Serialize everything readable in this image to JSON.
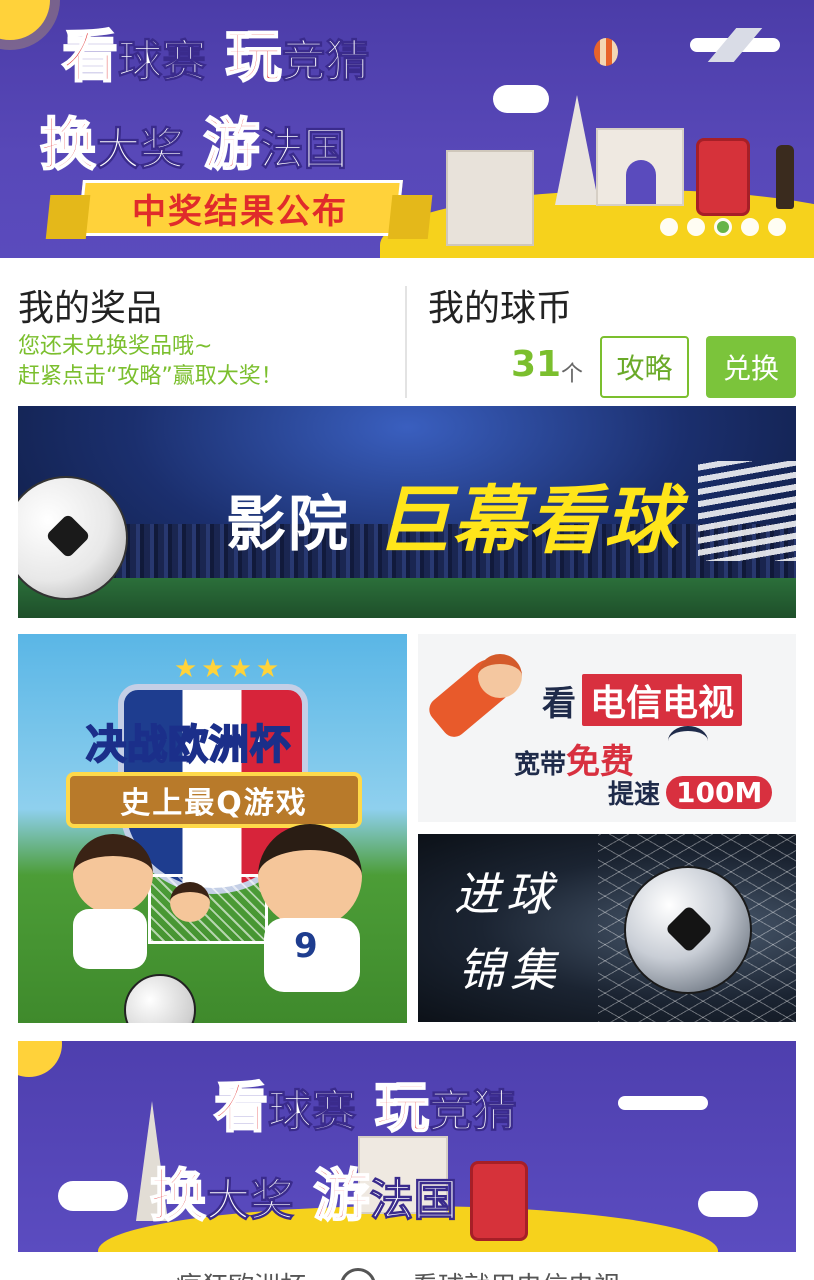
{
  "hero_banner": {
    "line1": {
      "big1": "看",
      "rest1": "球赛",
      "big2": "玩",
      "rest2": "竞猜"
    },
    "line2": {
      "big1": "换",
      "rest1": "大奖",
      "big2": "游",
      "rest2": "法国"
    },
    "ribbon": "中奖结果公布",
    "carousel": {
      "count": 5,
      "active_index": 3
    }
  },
  "prizes": {
    "title": "我的奖品",
    "line1": "您还未兑换奖品哦~",
    "line2": "赶紧点击“攻略”赢取大奖！"
  },
  "coins": {
    "title": "我的球币",
    "count": "31",
    "unit": "个",
    "guide_button": "攻略",
    "redeem_button": "兑换"
  },
  "cinema_banner": {
    "part1": "影院",
    "part2": "巨幕看球"
  },
  "euro_game": {
    "stars": "★★★★",
    "title": "决战欧洲杯",
    "subtitle": "史上最Q游戏"
  },
  "telecom": {
    "watch": "看",
    "tv": "电信电视",
    "broadband": "宽带",
    "free": "免费",
    "speedup": "提速",
    "speed": "100M"
  },
  "goals": {
    "line1": "进球",
    "line2": "锦集"
  },
  "bottom_banner": {
    "line1": {
      "big1": "看",
      "rest1": "球赛",
      "big2": "玩",
      "rest2": "竞猜"
    },
    "line2": {
      "big1": "换",
      "rest1": "大奖",
      "big2": "游",
      "rest2": "法国"
    }
  },
  "footer": {
    "left": "疯狂欧洲杯",
    "right": "看球就用电信电视"
  },
  "colors": {
    "accent_green": "#7bc43b",
    "brand_purple": "#4b3ca8",
    "red": "#d8303f",
    "yellow": "#ffd23a"
  }
}
